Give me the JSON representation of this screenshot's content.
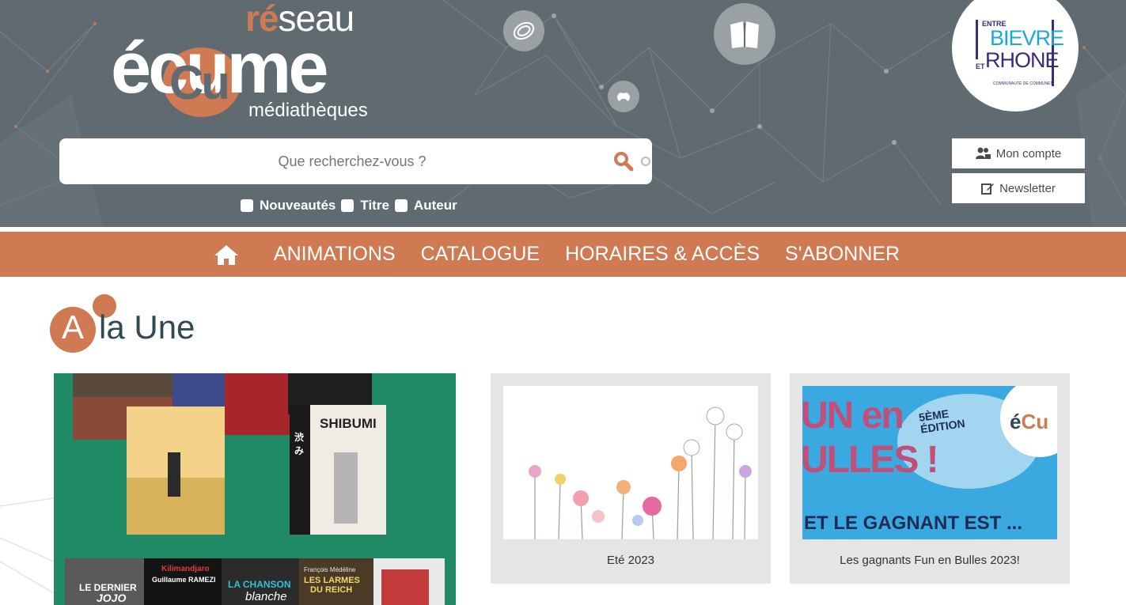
{
  "header": {
    "logo": {
      "reseau_prefix": "ré",
      "reseau_suffix": "seau",
      "ecume": "écume",
      "cu": "Cu",
      "mediatheques": "médiathèques"
    },
    "header_icons": [
      "vinyl-record-icon",
      "open-book-icon",
      "game-controller-icon"
    ],
    "partner_logo": {
      "entre": "ENTRE",
      "bievre": "BIEVRE",
      "et": "ET",
      "rhone": "RHONE",
      "subtitle": "COMMUNAUTÉ DE COMMUNES"
    },
    "search": {
      "placeholder": "Que recherchez-vous ?",
      "icon": "search-icon"
    },
    "filters": [
      {
        "label": "Nouveautés",
        "checked": false
      },
      {
        "label": "Titre",
        "checked": false
      },
      {
        "label": "Auteur",
        "checked": false
      }
    ],
    "account_button": {
      "label": "Mon compte",
      "icon": "users-lock-icon"
    },
    "newsletter_button": {
      "label": "Newsletter",
      "icon": "edit-icon"
    }
  },
  "nav": {
    "home_icon": "home-icon",
    "items": [
      {
        "label": "ANIMATIONS"
      },
      {
        "label": "CATALOGUE"
      },
      {
        "label": "HORAIRES & ACCÈS"
      },
      {
        "label": "S'ABONNER"
      }
    ]
  },
  "main": {
    "section_title": {
      "letter": "A",
      "rest": "la Une"
    },
    "feature": {
      "covers": [
        {
          "text_1": "SHIBUMI",
          "text_2": "渋み"
        },
        {
          "text_1": "LE DERNIER",
          "text_2": "JOJO"
        },
        {
          "text_1": "Kilimandjaro",
          "text_2": "Guillaume RAMEZI"
        },
        {
          "text_1": "LA CHANSON",
          "text_2": "blanche"
        },
        {
          "text_1": "LES LARMES",
          "text_2": "DU REICH"
        },
        {
          "text_1": "François Médéline"
        }
      ]
    },
    "cards": [
      {
        "caption": "Eté 2023"
      },
      {
        "caption": "Les gagnants Fun en Bulles 2023!",
        "image_text": {
          "line1": "UN en",
          "line2": "ULLES !",
          "edition": "5ÈME ÉDITION",
          "banner": "ET LE GAGNANT EST ..."
        }
      }
    ]
  },
  "colors": {
    "header_bg": "#5f6b71",
    "accent": "#cf7a52",
    "nav_text": "#ffffff",
    "title_text": "#2f4a55",
    "card_bg": "#e5e5e5",
    "feature_bg": "#1f8a63"
  }
}
